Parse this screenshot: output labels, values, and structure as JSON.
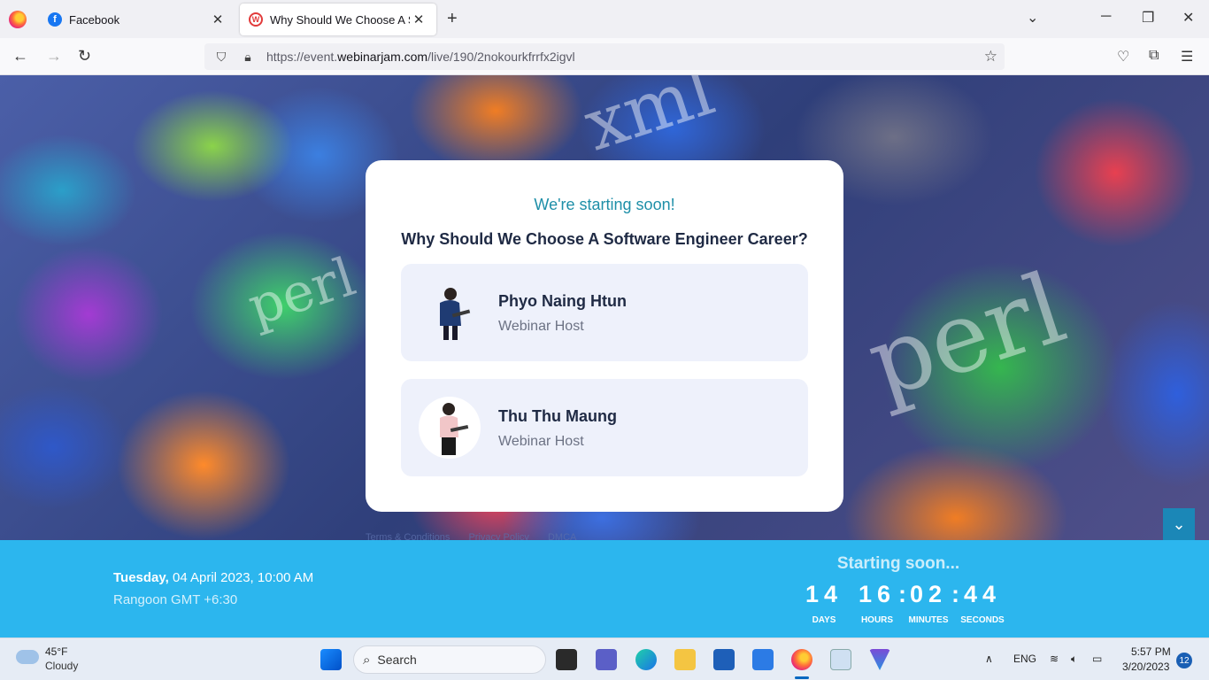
{
  "browser": {
    "tabs": [
      {
        "label": "Facebook"
      },
      {
        "label": "Why Should We Choose A Software Engineer Career?"
      }
    ],
    "url_prefix": "https://event.",
    "url_domain": "webinarjam.com",
    "url_path": "/live/190/2nokourkfrrfx2igvl"
  },
  "card": {
    "starting": "We're starting soon!",
    "title": "Why Should We Choose A Software Engineer Career?",
    "hosts": [
      {
        "name": "Phyo Naing Htun",
        "role": "Webinar Host"
      },
      {
        "name": "Thu Thu Maung",
        "role": "Webinar Host"
      }
    ]
  },
  "footer": {
    "links": [
      "Terms & Conditions",
      "Privacy Policy",
      "DMCA"
    ]
  },
  "schedule": {
    "weekday": "Tuesday,",
    "datetime": " 04 April 2023, 10:00 AM",
    "timezone": "Rangoon GMT +6:30",
    "status": "Starting soon...",
    "countdown": [
      {
        "value": "14",
        "label": "DAYS"
      },
      {
        "value": "16",
        "label": "HOURS"
      },
      {
        "value": "02",
        "label": "MINUTES"
      },
      {
        "value": "44",
        "label": "SECONDS"
      }
    ]
  },
  "taskbar": {
    "temperature": "45°F",
    "condition": "Cloudy",
    "search_placeholder": "Search",
    "language": "ENG",
    "time": "5:57 PM",
    "date": "3/20/2023",
    "notifications": "12"
  }
}
